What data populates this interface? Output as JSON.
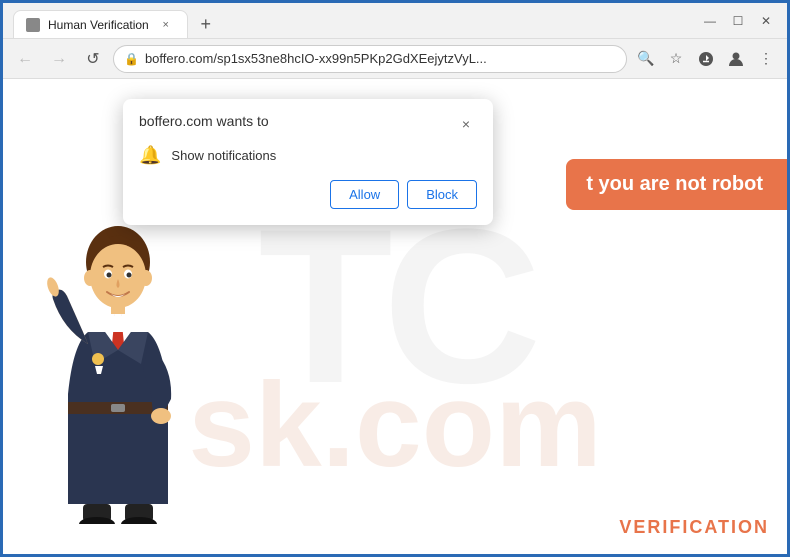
{
  "browser": {
    "tab": {
      "title": "Human Verification",
      "close_label": "×"
    },
    "new_tab_label": "+",
    "controls": {
      "minimize": "—",
      "maximize": "☐",
      "close": "✕"
    },
    "nav": {
      "back": "←",
      "forward": "→",
      "refresh": "↺"
    },
    "url": {
      "lock": "🔒",
      "address": "boffero.com/sp1sx53ne8hcIO-xx99n5PKp2GdXEejytzVyL..."
    },
    "url_actions": {
      "search": "🔍",
      "star": "☆",
      "account": "👤",
      "menu": "⋮",
      "download": "⬇"
    }
  },
  "popup": {
    "title": "boffero.com wants to",
    "close_label": "×",
    "notification_icon": "🔔",
    "notification_text": "Show notifications",
    "allow_label": "Allow",
    "block_label": "Block"
  },
  "page": {
    "robot_text": "t you are not robot",
    "watermark_top": "TC",
    "watermark_bottom": "sk.com",
    "verification_label": "VERIFICATION"
  }
}
